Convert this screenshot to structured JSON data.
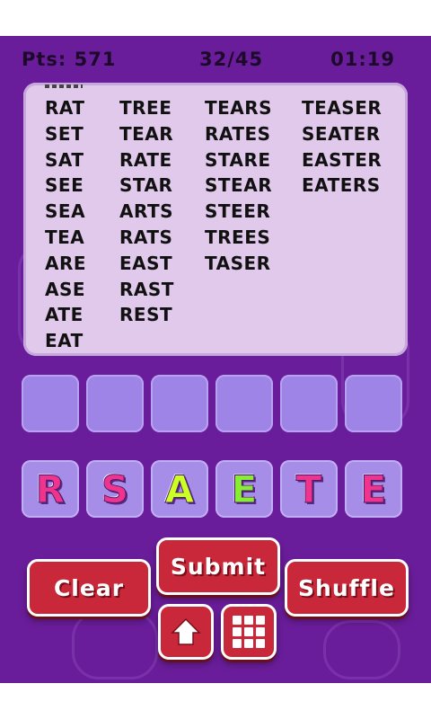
{
  "hud": {
    "points": "Pts: 571",
    "progress": "32/45",
    "timer": "01:19"
  },
  "found_words": {
    "column_1": [
      "RAT",
      "SET",
      "SAT",
      "SEE",
      "SEA",
      "TEA",
      "ARE",
      "ASE",
      "ATE",
      "EAT"
    ],
    "column_2": [
      "TREE",
      "TEAR",
      "RATE",
      "STAR",
      "ARTS",
      "RATS",
      "EAST",
      "RAST",
      "REST"
    ],
    "column_3": [
      "TEARS",
      "RATES",
      "STARE",
      "STEAR",
      "STEER",
      "TREES",
      "TASER"
    ],
    "column_4": [
      "TEASER",
      "SEATER",
      "EASTER",
      "EATERS"
    ]
  },
  "answer_slots": 6,
  "letter_tiles": [
    {
      "letter": "R",
      "color": "#f0338c"
    },
    {
      "letter": "S",
      "color": "#f0338c"
    },
    {
      "letter": "A",
      "color": "#ccff22"
    },
    {
      "letter": "E",
      "color": "#88ee33"
    },
    {
      "letter": "T",
      "color": "#f0338c"
    },
    {
      "letter": "E",
      "color": "#f0338c"
    }
  ],
  "buttons": {
    "clear": "Clear",
    "submit": "Submit",
    "shuffle": "Shuffle"
  },
  "icons": {
    "home": "home-icon",
    "levels": "grid-icon"
  },
  "colors": {
    "background": "#6a1d9a",
    "panel": "#e1c9ec",
    "slot": "#9e84e6",
    "button": "#c8283a"
  }
}
